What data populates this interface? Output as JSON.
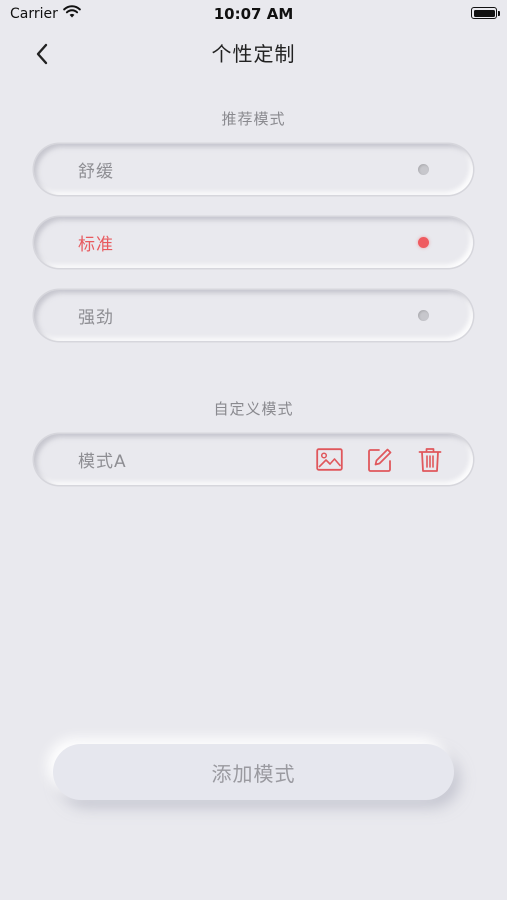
{
  "status_bar": {
    "carrier": "Carrier",
    "time": "10:07 AM",
    "battery_level": 1.0
  },
  "nav": {
    "title": "个性定制"
  },
  "recommended": {
    "section_title": "推荐模式",
    "options": [
      {
        "label": "舒缓",
        "selected": false
      },
      {
        "label": "标准",
        "selected": true
      },
      {
        "label": "强劲",
        "selected": false
      }
    ]
  },
  "custom": {
    "section_title": "自定义模式",
    "items": [
      {
        "label": "模式A",
        "icons": [
          "image-icon",
          "edit-icon",
          "delete-icon"
        ]
      }
    ]
  },
  "add_button": {
    "label": "添加模式"
  },
  "colors": {
    "background": "#e9e9ee",
    "accent": "#e85a5f",
    "muted_text": "#8e8e93"
  }
}
